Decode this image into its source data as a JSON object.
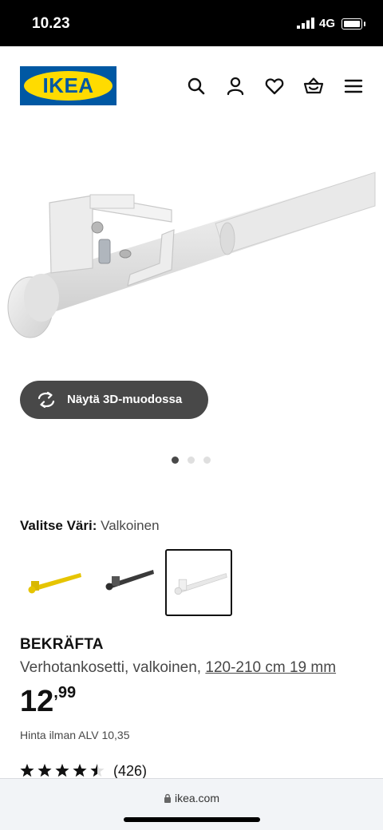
{
  "status_bar": {
    "time": "10.23",
    "network": "4G"
  },
  "header": {
    "logo_text": "IKEA",
    "icons": [
      "search-icon",
      "user-icon",
      "heart-icon",
      "basket-icon",
      "menu-icon"
    ]
  },
  "gallery": {
    "view_3d_label": "Näytä 3D-muodossa",
    "image_count": 3,
    "active_index": 0
  },
  "color_selector": {
    "label": "Valitse Väri:",
    "selected": "Valkoinen",
    "options": [
      "yellow",
      "black",
      "white"
    ],
    "selected_index": 2
  },
  "product": {
    "name": "BEKRÄFTA",
    "description": "Verhotankosetti, valkoinen, ",
    "size_link": "120-210 cm 19 mm",
    "price_integer": "12",
    "price_decimal": ",99",
    "price_ex_vat": "Hinta ilman ALV 10,35",
    "rating_value": 4.5,
    "review_count": "(426)"
  },
  "browser": {
    "url": "ikea.com"
  },
  "colors": {
    "brand_blue": "#0058a3",
    "brand_yellow": "#ffdb00",
    "button_dark": "#484848"
  }
}
